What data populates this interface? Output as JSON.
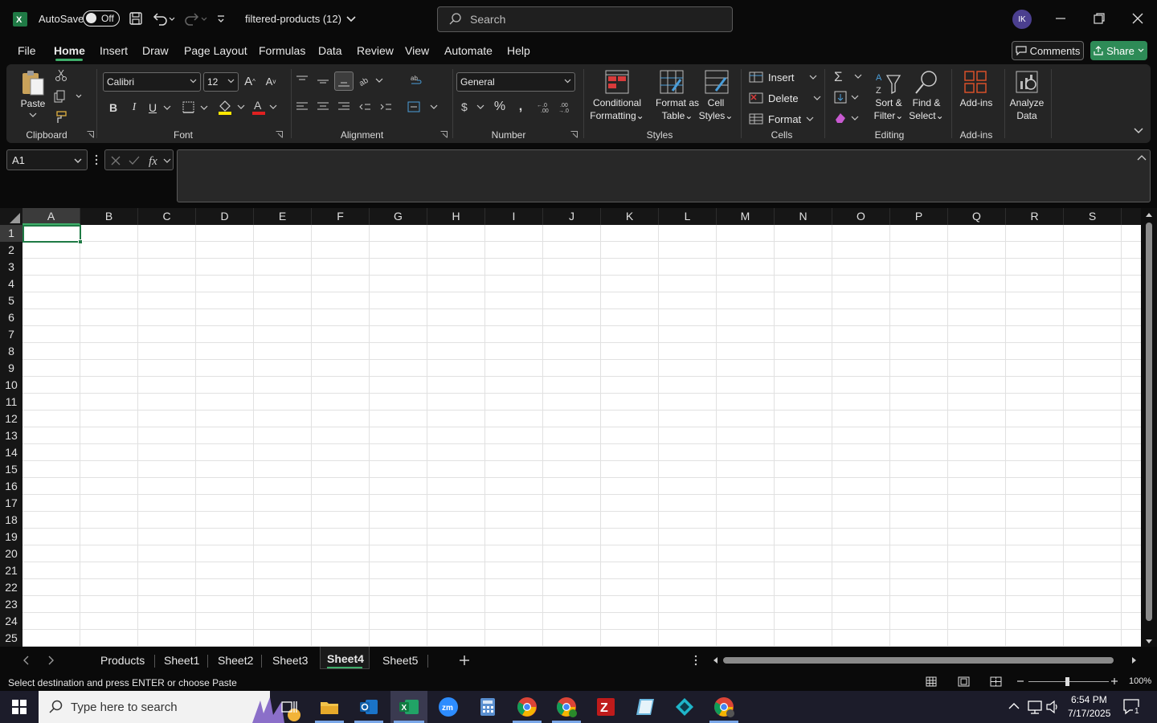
{
  "titlebar": {
    "autosave_label": "AutoSave",
    "autosave_state": "Off",
    "file_name": "filtered-products (12)",
    "search_placeholder": "Search",
    "user_initials": "IK"
  },
  "menu": {
    "tabs": [
      "File",
      "Home",
      "Insert",
      "Draw",
      "Page Layout",
      "Formulas",
      "Data",
      "Review",
      "View",
      "Automate",
      "Help"
    ],
    "active_tab": "Home",
    "comments_label": "Comments",
    "share_label": "Share"
  },
  "ribbon": {
    "clipboard": {
      "label": "Clipboard",
      "paste_label": "Paste"
    },
    "font": {
      "label": "Font",
      "font_name": "Calibri",
      "font_size": "12"
    },
    "alignment": {
      "label": "Alignment"
    },
    "number": {
      "label": "Number",
      "format": "General"
    },
    "styles": {
      "label": "Styles",
      "conditional_formatting": [
        "Conditional",
        "Formatting"
      ],
      "format_as_table": [
        "Format as",
        "Table"
      ],
      "cell_styles": [
        "Cell",
        "Styles"
      ]
    },
    "cells": {
      "label": "Cells",
      "insert": "Insert",
      "delete": "Delete",
      "format": "Format"
    },
    "editing": {
      "label": "Editing",
      "sort_filter": [
        "Sort &",
        "Filter"
      ],
      "find_select": [
        "Find &",
        "Select"
      ]
    },
    "addins": {
      "label": "Add-ins",
      "addins_btn": "Add-ins",
      "analyze": [
        "Analyze",
        "Data"
      ]
    }
  },
  "formula_bar": {
    "name_box": "A1",
    "formula": ""
  },
  "grid": {
    "columns": [
      "A",
      "B",
      "C",
      "D",
      "E",
      "F",
      "G",
      "H",
      "I",
      "J",
      "K",
      "L",
      "M",
      "N",
      "O",
      "P",
      "Q",
      "R",
      "S"
    ],
    "rows": [
      "1",
      "2",
      "3",
      "4",
      "5",
      "6",
      "7",
      "8",
      "9",
      "10",
      "11",
      "12",
      "13",
      "14",
      "15",
      "16",
      "17",
      "18",
      "19",
      "20",
      "21",
      "22",
      "23",
      "24",
      "25"
    ],
    "selected_cell": "A1"
  },
  "sheets": {
    "tabs": [
      "Products",
      "Sheet1",
      "Sheet2",
      "Sheet3",
      "Sheet4",
      "Sheet5"
    ],
    "active": "Sheet4"
  },
  "status": {
    "message": "Select destination and press ENTER or choose Paste",
    "zoom": "100%"
  },
  "taskbar": {
    "search_placeholder": "Type here to search",
    "time": "6:54 PM",
    "date": "7/17/2025",
    "notification_count": "1"
  },
  "colors": {
    "accent_green": "#2e8b57",
    "excel_green": "#1f7a45",
    "ribbon_bg": "#252525"
  }
}
